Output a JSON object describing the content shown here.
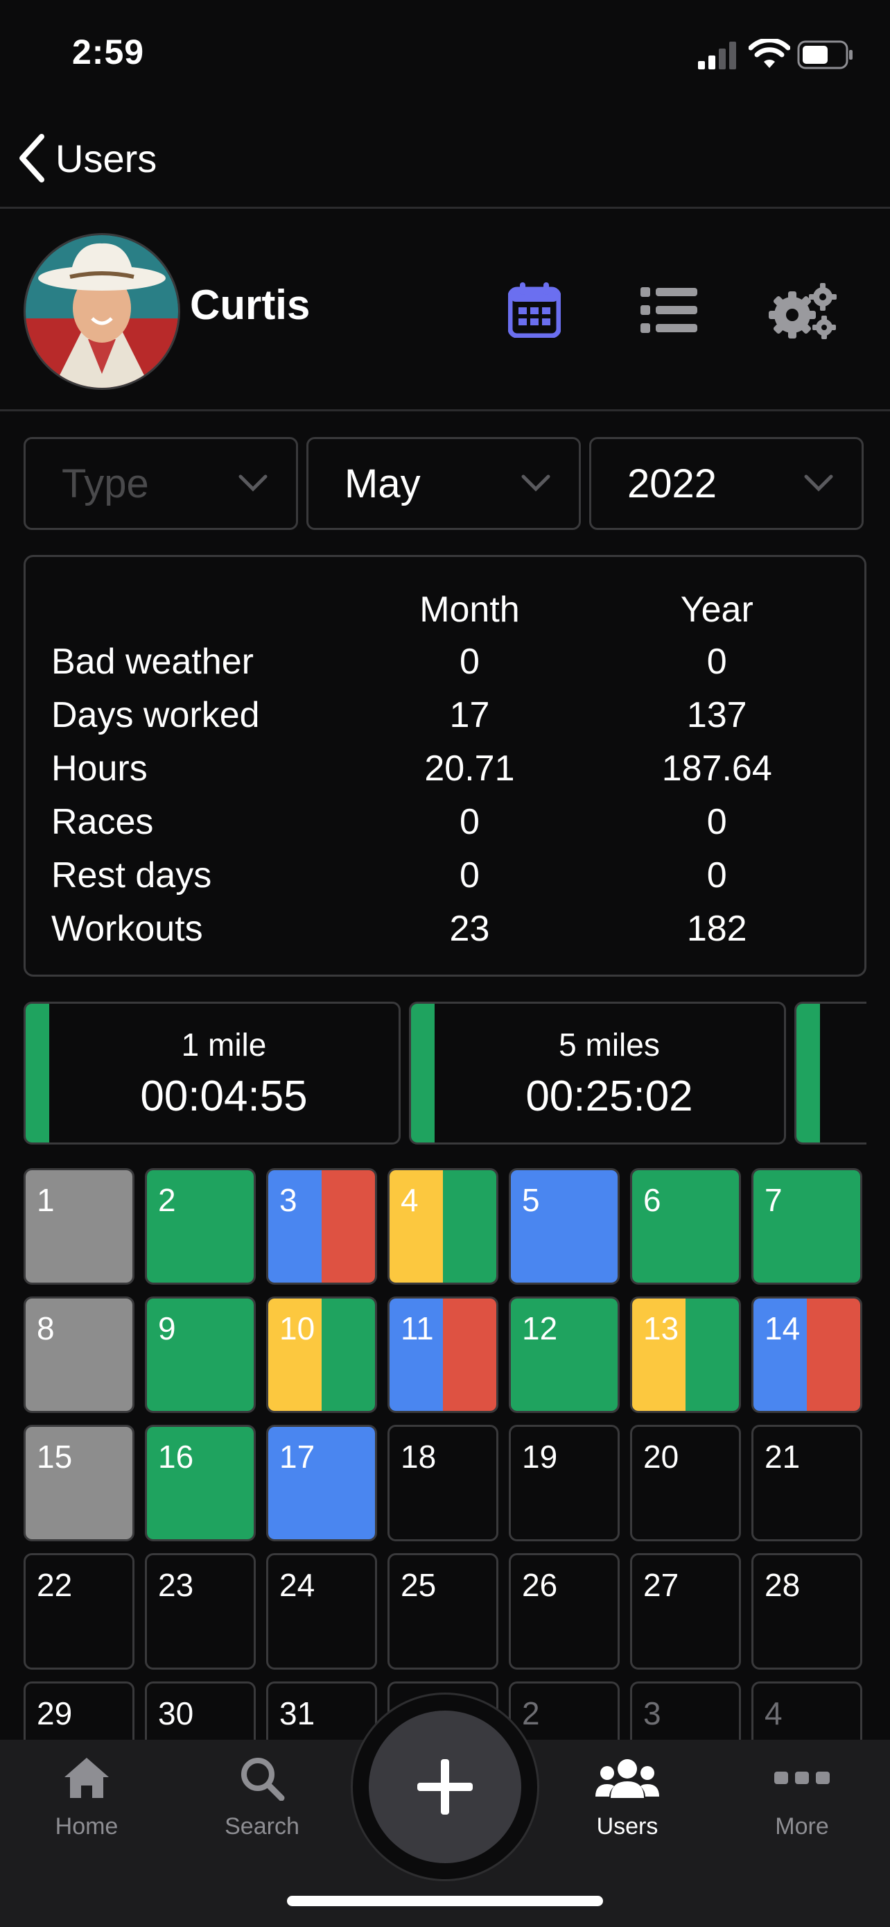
{
  "status_bar": {
    "time": "2:59"
  },
  "nav": {
    "back_label": "Users"
  },
  "profile": {
    "name": "Curtis"
  },
  "header_icons": [
    "calendar-icon",
    "list-icon",
    "gears-icon"
  ],
  "filters": {
    "type": {
      "placeholder": "Type",
      "value": ""
    },
    "month": {
      "value": "May"
    },
    "year": {
      "value": "2022"
    }
  },
  "stats": {
    "columns": [
      "Month",
      "Year"
    ],
    "rows": [
      {
        "label": "Bad weather",
        "month": "0",
        "year": "0"
      },
      {
        "label": "Days worked",
        "month": "17",
        "year": "137"
      },
      {
        "label": "Hours",
        "month": "20.71",
        "year": "187.64"
      },
      {
        "label": "Races",
        "month": "0",
        "year": "0"
      },
      {
        "label": "Rest days",
        "month": "0",
        "year": "0"
      },
      {
        "label": "Workouts",
        "month": "23",
        "year": "182"
      }
    ]
  },
  "records": [
    {
      "distance": "1 mile",
      "time": "00:04:55"
    },
    {
      "distance": "5 miles",
      "time": "00:25:02"
    },
    {
      "distance": "",
      "time": ""
    }
  ],
  "colors": {
    "green": "#1fa35f",
    "blue": "#4a86f0",
    "red": "#de5242",
    "yellow": "#fcc83f",
    "gray": "#8d8d8d",
    "accent": "#6b6ff0"
  },
  "calendar": {
    "days": [
      {
        "label": "1",
        "colors": [
          "gray"
        ]
      },
      {
        "label": "2",
        "colors": [
          "green"
        ]
      },
      {
        "label": "3",
        "colors": [
          "blue",
          "red"
        ]
      },
      {
        "label": "4",
        "colors": [
          "yellow",
          "green"
        ]
      },
      {
        "label": "5",
        "colors": [
          "blue"
        ]
      },
      {
        "label": "6",
        "colors": [
          "green"
        ]
      },
      {
        "label": "7",
        "colors": [
          "green"
        ]
      },
      {
        "label": "8",
        "colors": [
          "gray"
        ]
      },
      {
        "label": "9",
        "colors": [
          "green"
        ]
      },
      {
        "label": "10",
        "colors": [
          "yellow",
          "green"
        ]
      },
      {
        "label": "11",
        "colors": [
          "blue",
          "red"
        ]
      },
      {
        "label": "12",
        "colors": [
          "green"
        ]
      },
      {
        "label": "13",
        "colors": [
          "yellow",
          "green"
        ]
      },
      {
        "label": "14",
        "colors": [
          "blue",
          "red"
        ]
      },
      {
        "label": "15",
        "colors": [
          "gray"
        ]
      },
      {
        "label": "16",
        "colors": [
          "green"
        ]
      },
      {
        "label": "17",
        "colors": [
          "blue"
        ]
      },
      {
        "label": "18",
        "colors": []
      },
      {
        "label": "19",
        "colors": []
      },
      {
        "label": "20",
        "colors": []
      },
      {
        "label": "21",
        "colors": []
      },
      {
        "label": "22",
        "colors": []
      },
      {
        "label": "23",
        "colors": []
      },
      {
        "label": "24",
        "colors": []
      },
      {
        "label": "25",
        "colors": []
      },
      {
        "label": "26",
        "colors": []
      },
      {
        "label": "27",
        "colors": []
      },
      {
        "label": "28",
        "colors": []
      },
      {
        "label": "29",
        "colors": []
      },
      {
        "label": "30",
        "colors": []
      },
      {
        "label": "31",
        "colors": []
      },
      {
        "label": "1",
        "colors": [],
        "other_month": true
      },
      {
        "label": "2",
        "colors": [],
        "other_month": true
      },
      {
        "label": "3",
        "colors": [],
        "other_month": true
      },
      {
        "label": "4",
        "colors": [],
        "other_month": true
      }
    ]
  },
  "tabbar": {
    "home": "Home",
    "search": "Search",
    "users": "Users",
    "more": "More",
    "active": "users"
  }
}
